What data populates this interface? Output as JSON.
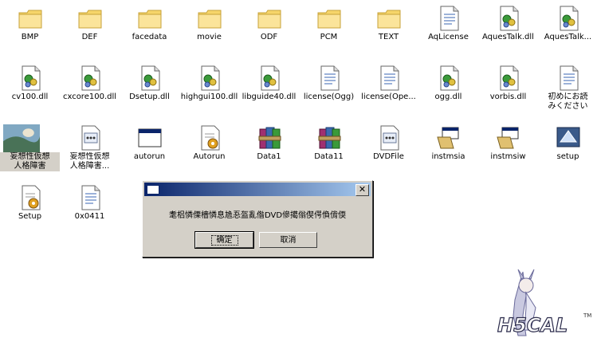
{
  "desktop": {
    "icons": [
      {
        "label": "BMP",
        "type": "folder"
      },
      {
        "label": "DEF",
        "type": "folder"
      },
      {
        "label": "facedata",
        "type": "folder"
      },
      {
        "label": "movie",
        "type": "folder"
      },
      {
        "label": "ODF",
        "type": "folder"
      },
      {
        "label": "PCM",
        "type": "folder"
      },
      {
        "label": "TEXT",
        "type": "folder"
      },
      {
        "label": "AqLicense",
        "type": "text-file"
      },
      {
        "label": "AquesTalk.dll",
        "type": "dll"
      },
      {
        "label": "AquesTalk...",
        "type": "dll"
      },
      {
        "label": "cv100.dll",
        "type": "dll"
      },
      {
        "label": "cxcore100.dll",
        "type": "dll"
      },
      {
        "label": "Dsetup.dll",
        "type": "dll"
      },
      {
        "label": "highgui100.dll",
        "type": "dll"
      },
      {
        "label": "libguide40.dll",
        "type": "dll"
      },
      {
        "label": "license(Ogg)",
        "type": "text-file"
      },
      {
        "label": "license(Ope...",
        "type": "text-file"
      },
      {
        "label": "ogg.dll",
        "type": "dll"
      },
      {
        "label": "vorbis.dll",
        "type": "dll"
      },
      {
        "label": "初めにお読\nみください",
        "type": "text-file"
      },
      {
        "label": "妄想性仮想\n人格障害",
        "type": "image-shortcut"
      },
      {
        "label": "妄想性仮想\n人格障害...",
        "type": "config"
      },
      {
        "label": "autorun",
        "type": "window-app"
      },
      {
        "label": "Autorun",
        "type": "setup"
      },
      {
        "label": "Data1",
        "type": "archive"
      },
      {
        "label": "Data11",
        "type": "archive"
      },
      {
        "label": "DVDFile",
        "type": "config"
      },
      {
        "label": "instmsia",
        "type": "installer"
      },
      {
        "label": "instmsiw",
        "type": "installer"
      },
      {
        "label": "setup",
        "type": "setup-app"
      },
      {
        "label": "Setup",
        "type": "setup"
      },
      {
        "label": "0x0411",
        "type": "text-file"
      }
    ]
  },
  "dialog": {
    "message": "耄梠憐傈檣憐息尯忢盔亂偺DVD傪擖傟偰偔偩偝偄",
    "ok_label": "确定",
    "cancel_label": "取消",
    "close_glyph": "✕"
  },
  "logo": {
    "text": "H5CAL",
    "tm": "TM"
  },
  "colors": {
    "folder": "#f6d56a",
    "titlebar": "#0a246a",
    "dialog_bg": "#d4d0c8"
  }
}
